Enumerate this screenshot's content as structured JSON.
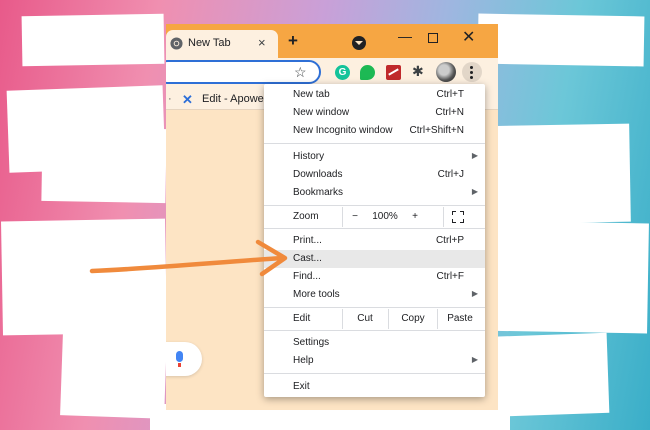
{
  "browser": {
    "tab": {
      "title": "New Tab",
      "close": "×"
    },
    "new_tab": "+",
    "window": {
      "minimize": "—",
      "close": "✕"
    },
    "toolbar": {
      "star": "☆",
      "grammarly_letter": "G",
      "puzzle": "✱"
    },
    "bookmarks_bar": {
      "separator": "·",
      "item": "Edit - Apower"
    }
  },
  "menu": {
    "group1": [
      {
        "label": "New tab",
        "shortcut": "Ctrl+T"
      },
      {
        "label": "New window",
        "shortcut": "Ctrl+N"
      },
      {
        "label": "New Incognito window",
        "shortcut": "Ctrl+Shift+N"
      }
    ],
    "group2": [
      {
        "label": "History",
        "shortcut": ""
      },
      {
        "label": "Downloads",
        "shortcut": "Ctrl+J"
      },
      {
        "label": "Bookmarks",
        "shortcut": ""
      }
    ],
    "zoom": {
      "label": "Zoom",
      "minus": "−",
      "value": "100%",
      "plus": "+"
    },
    "group3": [
      {
        "label": "Print...",
        "shortcut": "Ctrl+P"
      },
      {
        "label": "Cast...",
        "shortcut": ""
      },
      {
        "label": "Find...",
        "shortcut": "Ctrl+F"
      },
      {
        "label": "More tools",
        "shortcut": ""
      }
    ],
    "edit": {
      "label": "Edit",
      "cut": "Cut",
      "copy": "Copy",
      "paste": "Paste"
    },
    "group4": [
      {
        "label": "Settings",
        "shortcut": ""
      },
      {
        "label": "Help",
        "shortcut": ""
      }
    ],
    "exit": "Exit",
    "submenu_arrow": "▶",
    "highlighted_item": "Cast..."
  },
  "colors": {
    "title_bar": "#f6a643",
    "page_background": "#fde4c4",
    "annotation_arrow": "#f08a3c",
    "highlight_row": "#e8e8e8"
  }
}
